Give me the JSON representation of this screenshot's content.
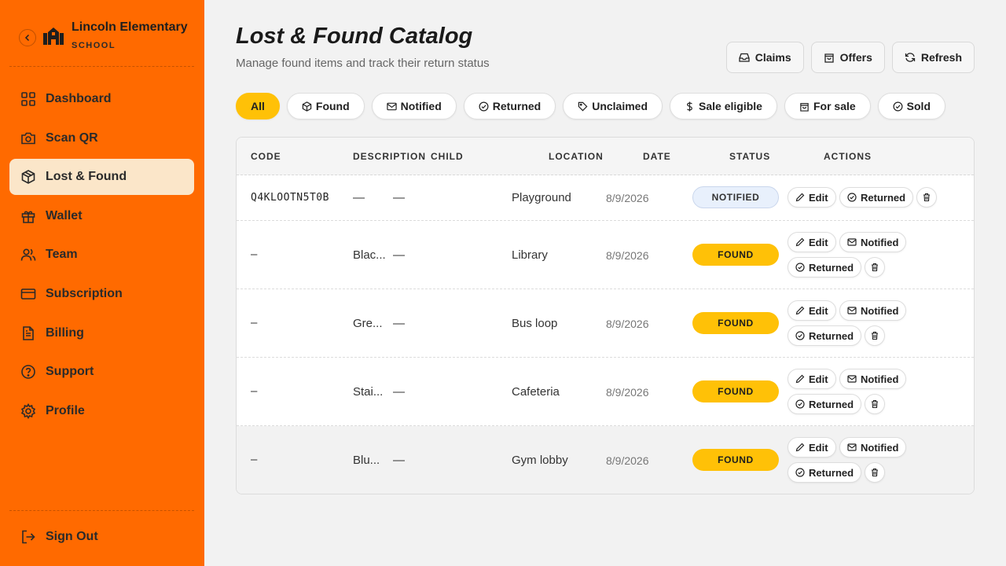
{
  "brand": {
    "name": "Lincoln Elementary",
    "subtitle": "SCHOOL"
  },
  "sidebar": {
    "items": [
      {
        "label": "Dashboard",
        "icon": "grid-icon"
      },
      {
        "label": "Scan QR",
        "icon": "camera-icon"
      },
      {
        "label": "Lost & Found",
        "icon": "box-icon",
        "active": true
      },
      {
        "label": "Wallet",
        "icon": "gift-icon"
      },
      {
        "label": "Team",
        "icon": "users-icon"
      },
      {
        "label": "Subscription",
        "icon": "card-icon"
      },
      {
        "label": "Billing",
        "icon": "document-icon"
      },
      {
        "label": "Support",
        "icon": "help-icon"
      },
      {
        "label": "Profile",
        "icon": "gear-icon"
      }
    ],
    "signout": "Sign Out"
  },
  "header": {
    "title": "Lost & Found Catalog",
    "subtitle": "Manage found items and track their return status",
    "actions": {
      "claims": "Claims",
      "offers": "Offers",
      "refresh": "Refresh"
    }
  },
  "filters": {
    "all": "All",
    "found": "Found",
    "notified": "Notified",
    "returned": "Returned",
    "unclaimed": "Unclaimed",
    "sale_eligible": "Sale eligible",
    "for_sale": "For sale",
    "sold": "Sold"
  },
  "table": {
    "columns": {
      "code": "CODE",
      "description": "DESCRIPTION",
      "child": "CHILD",
      "location": "LOCATION",
      "date": "DATE",
      "status": "STATUS",
      "actions": "ACTIONS"
    },
    "rows": [
      {
        "code": "Q4KLOOTN5T0B",
        "description": "—",
        "child": "—",
        "location": "Playground",
        "date": "8/9/2026",
        "status": "NOTIFIED"
      },
      {
        "code": "–",
        "description": "Blac...",
        "child": "—",
        "location": "Library",
        "date": "8/9/2026",
        "status": "FOUND"
      },
      {
        "code": "–",
        "description": "Gre...",
        "child": "—",
        "location": "Bus loop",
        "date": "8/9/2026",
        "status": "FOUND"
      },
      {
        "code": "–",
        "description": "Stai...",
        "child": "—",
        "location": "Cafeteria",
        "date": "8/9/2026",
        "status": "FOUND"
      },
      {
        "code": "–",
        "description": "Blu...",
        "child": "—",
        "location": "Gym lobby",
        "date": "8/9/2026",
        "status": "FOUND"
      }
    ],
    "action_labels": {
      "edit": "Edit",
      "notified": "Notified",
      "returned": "Returned"
    }
  },
  "colors": {
    "sidebar": "#ff6a00",
    "accent": "#ffc107",
    "active_nav": "#fbe6c9",
    "notified_badge": "#e8f0fc"
  }
}
